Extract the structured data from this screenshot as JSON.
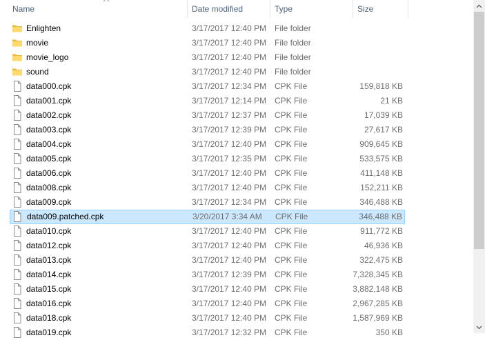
{
  "columns": {
    "name": "Name",
    "date": "Date modified",
    "type": "Type",
    "size": "Size"
  },
  "files": [
    {
      "name": "Enlighten",
      "date": "3/17/2017 12:40 PM",
      "type": "File folder",
      "size": "",
      "kind": "folder"
    },
    {
      "name": "movie",
      "date": "3/17/2017 12:40 PM",
      "type": "File folder",
      "size": "",
      "kind": "folder"
    },
    {
      "name": "movie_logo",
      "date": "3/17/2017 12:40 PM",
      "type": "File folder",
      "size": "",
      "kind": "folder"
    },
    {
      "name": "sound",
      "date": "3/17/2017 12:40 PM",
      "type": "File folder",
      "size": "",
      "kind": "folder"
    },
    {
      "name": "data000.cpk",
      "date": "3/17/2017 12:34 PM",
      "type": "CPK File",
      "size": "159,818 KB",
      "kind": "file"
    },
    {
      "name": "data001.cpk",
      "date": "3/17/2017 12:14 PM",
      "type": "CPK File",
      "size": "21 KB",
      "kind": "file"
    },
    {
      "name": "data002.cpk",
      "date": "3/17/2017 12:37 PM",
      "type": "CPK File",
      "size": "17,039 KB",
      "kind": "file"
    },
    {
      "name": "data003.cpk",
      "date": "3/17/2017 12:39 PM",
      "type": "CPK File",
      "size": "27,617 KB",
      "kind": "file"
    },
    {
      "name": "data004.cpk",
      "date": "3/17/2017 12:40 PM",
      "type": "CPK File",
      "size": "909,645 KB",
      "kind": "file"
    },
    {
      "name": "data005.cpk",
      "date": "3/17/2017 12:35 PM",
      "type": "CPK File",
      "size": "533,575 KB",
      "kind": "file"
    },
    {
      "name": "data006.cpk",
      "date": "3/17/2017 12:40 PM",
      "type": "CPK File",
      "size": "411,148 KB",
      "kind": "file"
    },
    {
      "name": "data008.cpk",
      "date": "3/17/2017 12:40 PM",
      "type": "CPK File",
      "size": "152,211 KB",
      "kind": "file"
    },
    {
      "name": "data009.cpk",
      "date": "3/17/2017 12:34 PM",
      "type": "CPK File",
      "size": "346,488 KB",
      "kind": "file"
    },
    {
      "name": "data009.patched.cpk",
      "date": "3/20/2017 3:34 AM",
      "type": "CPK File",
      "size": "346,488 KB",
      "kind": "file",
      "selected": true
    },
    {
      "name": "data010.cpk",
      "date": "3/17/2017 12:40 PM",
      "type": "CPK File",
      "size": "911,772 KB",
      "kind": "file"
    },
    {
      "name": "data012.cpk",
      "date": "3/17/2017 12:40 PM",
      "type": "CPK File",
      "size": "46,936 KB",
      "kind": "file"
    },
    {
      "name": "data013.cpk",
      "date": "3/17/2017 12:40 PM",
      "type": "CPK File",
      "size": "322,475 KB",
      "kind": "file"
    },
    {
      "name": "data014.cpk",
      "date": "3/17/2017 12:39 PM",
      "type": "CPK File",
      "size": "7,328,345 KB",
      "kind": "file"
    },
    {
      "name": "data015.cpk",
      "date": "3/17/2017 12:40 PM",
      "type": "CPK File",
      "size": "3,882,148 KB",
      "kind": "file"
    },
    {
      "name": "data016.cpk",
      "date": "3/17/2017 12:40 PM",
      "type": "CPK File",
      "size": "2,967,285 KB",
      "kind": "file"
    },
    {
      "name": "data018.cpk",
      "date": "3/17/2017 12:40 PM",
      "type": "CPK File",
      "size": "1,587,969 KB",
      "kind": "file"
    },
    {
      "name": "data019.cpk",
      "date": "3/17/2017 12:32 PM",
      "type": "CPK File",
      "size": "350 KB",
      "kind": "file"
    }
  ],
  "colors": {
    "selection_bg": "#cce8ff",
    "selection_border": "#99d1ff",
    "folder_yellow": "#ffd96b",
    "header_text": "#4c607a"
  }
}
